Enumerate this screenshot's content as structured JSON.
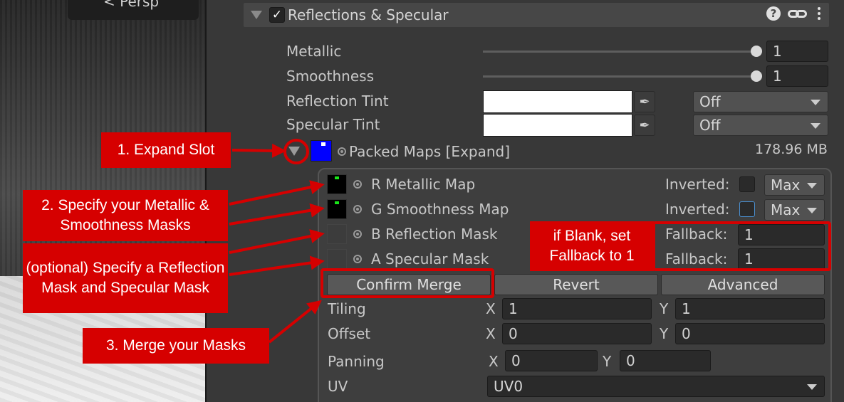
{
  "scene": {
    "view_label": "< Persp"
  },
  "section": {
    "title": "Reflections & Specular",
    "enabled": true
  },
  "properties": {
    "metallic": {
      "label": "Metallic",
      "value": "1",
      "slider_fraction": 1.0
    },
    "smoothness": {
      "label": "Smoothness",
      "value": "1",
      "slider_fraction": 1.0
    },
    "reflection_tint": {
      "label": "Reflection Tint",
      "color": "#ffffff",
      "mode": "Off"
    },
    "specular_tint": {
      "label": "Specular Tint",
      "color": "#ffffff",
      "mode": "Off"
    }
  },
  "packed_maps": {
    "label": "Packed Maps [Expand]",
    "size": "178.96 MB",
    "slot_color": "#0000ff",
    "channels": [
      {
        "label": "R Metallic Map",
        "side_label": "Inverted:",
        "mode": "Max"
      },
      {
        "label": "G Smoothness Map",
        "side_label": "Inverted:",
        "mode": "Max"
      },
      {
        "label": "B Reflection Mask",
        "side_label": "Fallback:",
        "fallback": "1"
      },
      {
        "label": "A Specular Mask",
        "side_label": "Fallback:",
        "fallback": "1"
      }
    ],
    "buttons": {
      "confirm": "Confirm Merge",
      "revert": "Revert",
      "advanced": "Advanced"
    },
    "tiling": {
      "label": "Tiling",
      "x_label": "X",
      "x": "1",
      "y_label": "Y",
      "y": "1"
    },
    "offset": {
      "label": "Offset",
      "x_label": "X",
      "x": "0",
      "y_label": "Y",
      "y": "0"
    },
    "panning": {
      "label": "Panning",
      "x_label": "X",
      "x": "0",
      "y_label": "Y",
      "y": "0"
    },
    "uv": {
      "label": "UV",
      "value": "UV0"
    }
  },
  "annotations": {
    "step1": "1. Expand Slot",
    "step2": "2. Specify your Metallic & Smoothness Masks",
    "optional": "(optional) Specify a Reflection Mask and Specular Mask",
    "step3": "3. Merge your Masks",
    "fallback_note": "if Blank, set Fallback to 1",
    "color": "#d60000"
  }
}
